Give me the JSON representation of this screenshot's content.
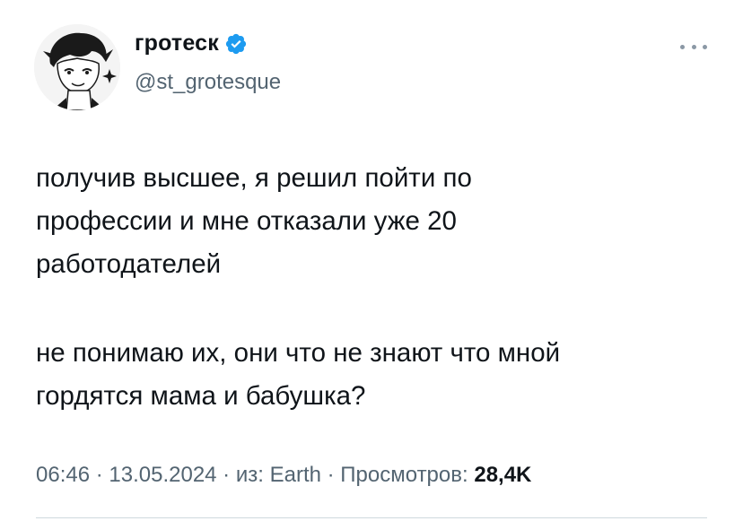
{
  "author": {
    "display_name": "гротеск",
    "handle": "@st_grotesque",
    "verified": true,
    "avatar": "avatar-image",
    "verified_icon": "verified-badge-icon",
    "more_icon": "more-options-icon"
  },
  "tweet": {
    "paragraph_1": [
      "получив высшее, я решил пойти по",
      "профессии и мне отказали уже 20",
      "работодателей"
    ],
    "paragraph_2": [
      "не понимаю их, они что не знают что мной",
      "гордятся мама и бабушка?"
    ]
  },
  "meta": {
    "time": "06:46",
    "separator": " · ",
    "date": "13.05.2024",
    "source_prefix": "из: ",
    "source": "Earth",
    "views_label": "Просмотров: ",
    "views_count": "28,4K"
  },
  "colors": {
    "text": "#0f1419",
    "secondary": "#536471",
    "verified": "#1d9bf0",
    "divider": "#cfd9de"
  }
}
